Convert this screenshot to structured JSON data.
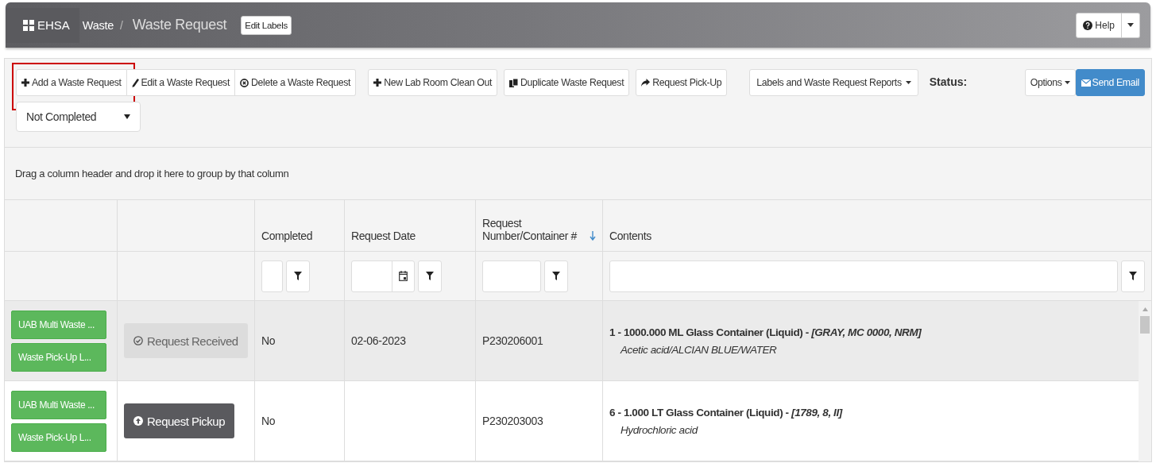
{
  "header": {
    "app": "EHSA",
    "breadcrumb": [
      {
        "label": "Waste"
      },
      {
        "label": "Waste Request"
      }
    ],
    "separator": "/",
    "edit_labels": "Edit Labels",
    "help": "Help"
  },
  "toolbar": {
    "groups": [
      [
        {
          "kind": "plus",
          "label": "Add a Waste Request",
          "highlighted": true
        },
        {
          "kind": "pencil",
          "label": "Edit a Waste Request",
          "highlighted": false
        },
        {
          "kind": "delete",
          "label": "Delete a Waste Request",
          "highlighted": false
        }
      ],
      [
        {
          "kind": "plus",
          "label": "New Lab Room Clean Out",
          "highlighted": false
        }
      ],
      [
        {
          "kind": "copy",
          "label": "Duplicate Waste Request",
          "highlighted": false
        }
      ],
      [
        {
          "kind": "share",
          "label": "Request Pick-Up",
          "highlighted": false
        }
      ]
    ],
    "reports": "Labels and Waste Request Reports",
    "status_label": "Status:",
    "options": "Options",
    "send_email": "Send Email",
    "status_select": "Not Completed"
  },
  "group_hint": "Drag a column header and drop it here to group by that column",
  "table": {
    "columns": [
      {
        "label": "Completed",
        "kind": "text",
        "sorted_descending": false
      },
      {
        "label": "Request Date",
        "kind": "date",
        "sorted_descending": false
      },
      {
        "label": "Request Number/Container #",
        "kind": "text",
        "sorted_descending": true
      },
      {
        "label": "Contents",
        "kind": "text",
        "sorted_descending": false
      }
    ],
    "rows": [
      {
        "selected": true,
        "labels": [
          "UAB Multi Waste ...",
          "Waste Pick-Up L..."
        ],
        "action": {
          "kind": "received",
          "label": "Request Received"
        },
        "completed": "No",
        "request_date": "02-06-2023",
        "request_number": "P230206001",
        "contents": {
          "line": "1 - 1000.000 ML Glass Container (Liquid) - *[GRAY, MC 0000, NRM]*",
          "detail": "Acetic acid/ALCIAN BLUE/WATER"
        }
      },
      {
        "selected": false,
        "labels": [
          "UAB Multi Waste ...",
          "Waste Pick-Up L..."
        ],
        "action": {
          "kind": "pickup",
          "label": "Request Pickup"
        },
        "completed": "No",
        "request_number": "P230203003",
        "contents": {
          "line": "6 - 1.000 LT Glass Container (Liquid) - *[1789, 8, II]*",
          "detail": "Hydrochloric acid"
        }
      }
    ]
  }
}
